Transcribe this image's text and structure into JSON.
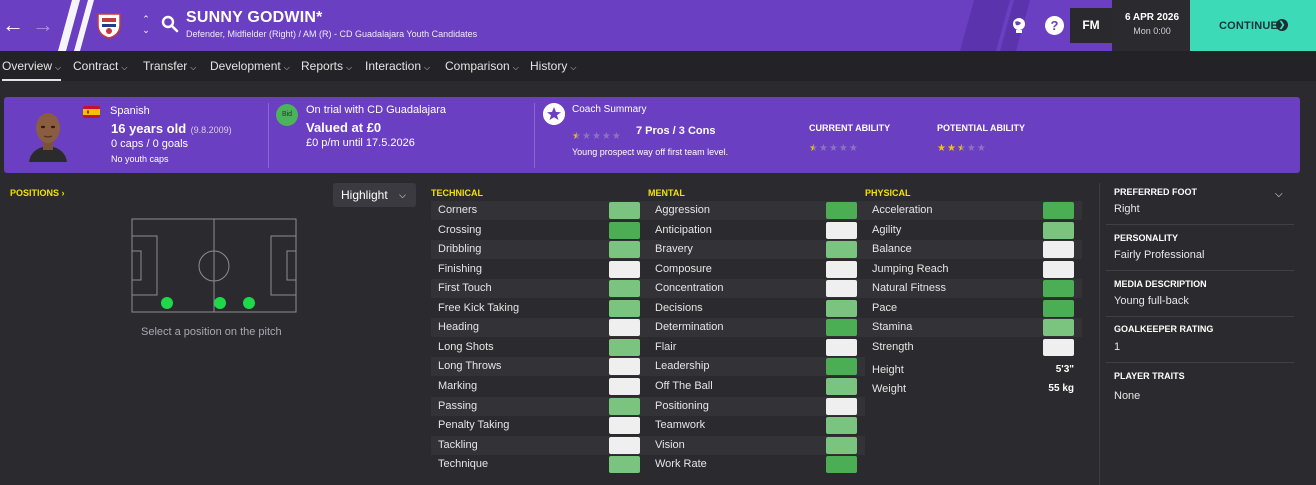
{
  "header": {
    "player_name": "SUNNY GODWIN*",
    "player_subtitle": "Defender, Midfielder (Right) / AM (R) - CD Guadalajara Youth Candidates",
    "date": "6 APR 2026",
    "time": "Mon 0:00",
    "fm_logo": "FM",
    "help_glyph": "?",
    "continue_label": "CONTINUE",
    "icons": [
      "back-arrow-icon",
      "forward-arrow-icon",
      "club-crest-icon",
      "up-down-icon",
      "search-icon",
      "globe-icon",
      "help-icon",
      "continue-arrow-icon"
    ]
  },
  "tabs": [
    {
      "label": "Overview",
      "active": true
    },
    {
      "label": "Contract",
      "active": false
    },
    {
      "label": "Transfer",
      "active": false
    },
    {
      "label": "Development",
      "active": false
    },
    {
      "label": "Reports",
      "active": false
    },
    {
      "label": "Interaction",
      "active": false
    },
    {
      "label": "Comparison",
      "active": false
    },
    {
      "label": "History",
      "active": false
    }
  ],
  "card": {
    "nationality": "Spanish",
    "age": "16 years old",
    "dob": "(9.8.2009)",
    "caps": "0 caps / 0 goals",
    "youth_caps": "No youth caps",
    "bid_badge": "Bid",
    "trial": "On trial with CD Guadalajara",
    "valuation": "Valued at £0",
    "wage": "£0 p/m until 17.5.2026",
    "coach_title": "Coach Summary",
    "pros_cons": "7 Pros / 3 Cons",
    "coach_note": "Young prospect way off first team level.",
    "coach_stars": 0.5,
    "current_ability_label": "CURRENT ABILITY",
    "current_ability_stars": 0.5,
    "potential_ability_label": "POTENTIAL ABILITY",
    "potential_ability_stars": 2.5
  },
  "positions": {
    "title": "POSITIONS",
    "highlight_label": "Highlight",
    "hint": "Select a position on the pitch",
    "dot_color": "#1fd94a"
  },
  "technical": {
    "title": "TECHNICAL",
    "attributes": [
      "Corners",
      "Crossing",
      "Dribbling",
      "Finishing",
      "First Touch",
      "Free Kick Taking",
      "Heading",
      "Long Shots",
      "Long Throws",
      "Marking",
      "Passing",
      "Penalty Taking",
      "Tackling",
      "Technique"
    ],
    "levels": [
      "mid",
      "high",
      "mid",
      "low",
      "mid",
      "mid",
      "low",
      "mid",
      "low",
      "low",
      "mid",
      "low",
      "low",
      "mid"
    ]
  },
  "mental": {
    "title": "MENTAL",
    "attributes": [
      "Aggression",
      "Anticipation",
      "Bravery",
      "Composure",
      "Concentration",
      "Decisions",
      "Determination",
      "Flair",
      "Leadership",
      "Off The Ball",
      "Positioning",
      "Teamwork",
      "Vision",
      "Work Rate"
    ],
    "levels": [
      "high",
      "low",
      "mid",
      "low",
      "low",
      "mid",
      "high",
      "low",
      "high",
      "mid",
      "low",
      "mid",
      "mid",
      "high"
    ]
  },
  "physical": {
    "title": "PHYSICAL",
    "attributes": [
      "Acceleration",
      "Agility",
      "Balance",
      "Jumping Reach",
      "Natural Fitness",
      "Pace",
      "Stamina",
      "Strength"
    ],
    "levels": [
      "high",
      "mid",
      "low",
      "low",
      "high",
      "high",
      "mid",
      "low"
    ],
    "height_label": "Height",
    "height": "5'3\"",
    "weight_label": "Weight",
    "weight": "55 kg"
  },
  "colors": {
    "low": "#efefef",
    "mid": "#7bc47f",
    "high": "#4bae55",
    "accent": "#6a3fc1",
    "continue": "#3ddab8",
    "section_title": "#f5e100"
  },
  "info": {
    "preferred_foot_label": "PREFERRED FOOT",
    "preferred_foot": "Right",
    "personality_label": "PERSONALITY",
    "personality": "Fairly Professional",
    "media_label": "MEDIA DESCRIPTION",
    "media": "Young full-back",
    "gk_label": "GOALKEEPER RATING",
    "gk": "1",
    "traits_label": "PLAYER TRAITS",
    "traits": "None"
  }
}
